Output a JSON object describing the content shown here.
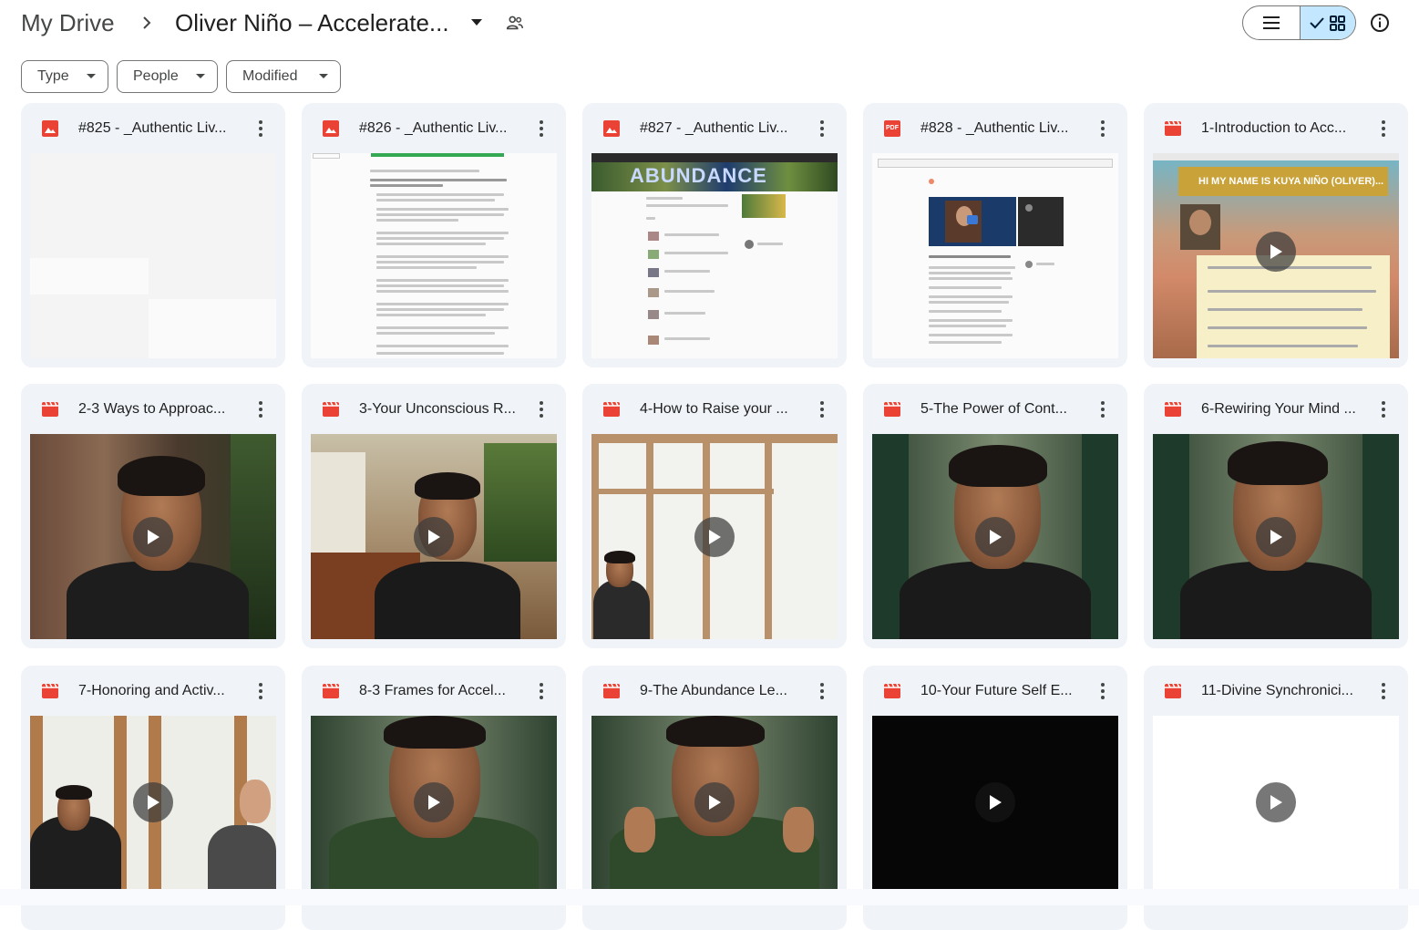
{
  "breadcrumb": {
    "root": "My Drive",
    "current": "Oliver Niño – Accelerate..."
  },
  "filters": [
    {
      "label": "Type"
    },
    {
      "label": "People"
    },
    {
      "label": "Modified"
    }
  ],
  "files": [
    {
      "name": "#825 - _Authentic Liv...",
      "type": "image"
    },
    {
      "name": "#826 - _Authentic Liv...",
      "type": "image"
    },
    {
      "name": "#827 - _Authentic Liv...",
      "type": "image"
    },
    {
      "name": "#828 - _Authentic Liv...",
      "type": "pdf"
    },
    {
      "name": "1-Introduction to Acc...",
      "type": "video"
    },
    {
      "name": "2-3 Ways to Approac...",
      "type": "video"
    },
    {
      "name": "3-Your Unconscious R...",
      "type": "video"
    },
    {
      "name": "4-How to Raise your ...",
      "type": "video"
    },
    {
      "name": "5-The Power of Cont...",
      "type": "video"
    },
    {
      "name": "6-Rewiring Your Mind ...",
      "type": "video"
    },
    {
      "name": "7-Honoring and Activ...",
      "type": "video"
    },
    {
      "name": "8-3 Frames for Accel...",
      "type": "video"
    },
    {
      "name": "9-The Abundance Le...",
      "type": "video"
    },
    {
      "name": "10-Your Future Self E...",
      "type": "video"
    },
    {
      "name": "11-Divine Synchronici...",
      "type": "video"
    }
  ],
  "thumb_text": {
    "abundance": "ABUNDANCE",
    "intro_banner": "HI MY NAME IS KUYA NIÑO (OLIVER)...",
    "pdf_badge": "PDF"
  },
  "colors": {
    "accent": "#c2e7ff",
    "card_bg": "#f0f4f9",
    "image_icon": "#ea4335",
    "video_icon": "#ea4335",
    "pdf_icon": "#ea4335"
  }
}
